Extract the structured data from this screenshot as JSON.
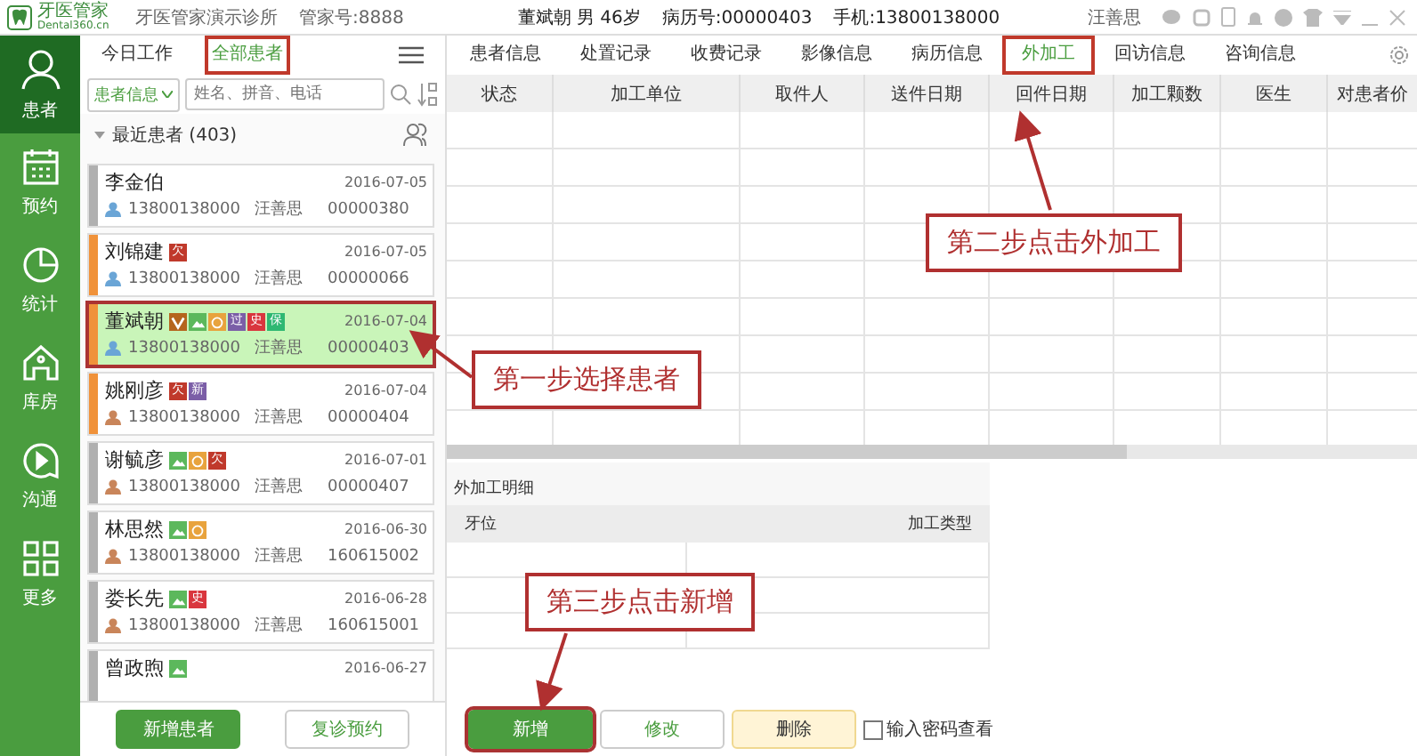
{
  "top_bar": {
    "logo_title": "牙医管家",
    "logo_subtitle": "Dental360.cn",
    "clinic": "牙医管家演示诊所",
    "account": "管家号:8888",
    "patient": "董斌朝 男 46岁",
    "record_no": "病历号:00000403",
    "phone": "手机:13800138000",
    "user": "汪善思"
  },
  "sidebar": {
    "items": [
      {
        "label": "患者",
        "selected": true
      },
      {
        "label": "预约",
        "selected": false
      },
      {
        "label": "统计",
        "selected": false
      },
      {
        "label": "库房",
        "selected": false
      },
      {
        "label": "沟通",
        "selected": false
      },
      {
        "label": "更多",
        "selected": false
      }
    ]
  },
  "patient_panel": {
    "tabs": [
      {
        "label": "今日工作",
        "selected": false,
        "highlighted": false
      },
      {
        "label": "全部患者",
        "selected": true,
        "highlighted": true
      }
    ],
    "filter": "患者信息",
    "search_placeholder": "姓名、拼音、电话",
    "group_title": "最近患者 (403)",
    "patients": [
      {
        "name": "李金伯",
        "date": "2016-07-05",
        "phone": "13800138000",
        "doctor": "汪善思",
        "id": "00000380",
        "color": "#b0b0b0",
        "kind": "male",
        "selected": false,
        "highlighted": false
      },
      {
        "name": "刘锦建",
        "date": "2016-07-05",
        "phone": "13800138000",
        "doctor": "汪善思",
        "id": "00000066",
        "color": "#f0923a",
        "kind": "male",
        "selected": false,
        "highlighted": false,
        "tags": [
          {
            "kind": "text",
            "text": "欠",
            "color": "#c0392b"
          }
        ]
      },
      {
        "name": "董斌朝",
        "date": "2016-07-04",
        "phone": "13800138000",
        "doctor": "汪善思",
        "id": "00000403",
        "color": "#f0923a",
        "kind": "male",
        "selected": true,
        "highlighted": true,
        "tags": [
          {
            "kind": "vip",
            "color": "#b5651d"
          },
          {
            "kind": "image",
            "color": "#5cb85c"
          },
          {
            "kind": "face",
            "color": "#e8a33d"
          },
          {
            "kind": "text",
            "text": "过",
            "color": "#7b5ea7"
          },
          {
            "kind": "text",
            "text": "史",
            "color": "#d9363e"
          },
          {
            "kind": "text",
            "text": "保",
            "color": "#2eb872"
          }
        ]
      },
      {
        "name": "姚刚彦",
        "date": "2016-07-04",
        "phone": "13800138000",
        "doctor": "汪善思",
        "id": "00000404",
        "color": "#f0923a",
        "kind": "female",
        "selected": false,
        "highlighted": false,
        "tags": [
          {
            "kind": "text",
            "text": "欠",
            "color": "#c0392b"
          },
          {
            "kind": "text",
            "text": "新",
            "color": "#7b5ea7"
          }
        ]
      },
      {
        "name": "谢毓彦",
        "date": "2016-07-01",
        "phone": "13800138000",
        "doctor": "汪善思",
        "id": "00000407",
        "color": "#b0b0b0",
        "kind": "female",
        "selected": false,
        "highlighted": false,
        "tags": [
          {
            "kind": "image",
            "color": "#5cb85c"
          },
          {
            "kind": "face",
            "color": "#e8a33d"
          },
          {
            "kind": "text",
            "text": "欠",
            "color": "#c0392b"
          }
        ]
      },
      {
        "name": "林思然",
        "date": "2016-06-30",
        "phone": "13800138000",
        "doctor": "汪善思",
        "id": "160615002",
        "color": "#b0b0b0",
        "kind": "female",
        "selected": false,
        "highlighted": false,
        "tags": [
          {
            "kind": "image",
            "color": "#5cb85c"
          },
          {
            "kind": "face",
            "color": "#e8a33d"
          }
        ]
      },
      {
        "name": "娄长先",
        "date": "2016-06-28",
        "phone": "13800138000",
        "doctor": "汪善思",
        "id": "160615001",
        "color": "#b0b0b0",
        "kind": "female",
        "selected": false,
        "highlighted": false,
        "tags": [
          {
            "kind": "image",
            "color": "#5cb85c"
          },
          {
            "kind": "text",
            "text": "史",
            "color": "#d9363e"
          }
        ]
      },
      {
        "name": "曾政煦",
        "date": "2016-06-27",
        "color": "#b0b0b0",
        "selected": false,
        "highlighted": false,
        "tags": [
          {
            "kind": "image",
            "color": "#5cb85c"
          }
        ]
      }
    ],
    "buttons": [
      {
        "label": "新增患者",
        "kind": "primary"
      },
      {
        "label": "复诊预约",
        "kind": "outline"
      }
    ]
  },
  "detail": {
    "tabs": [
      {
        "label": "患者信息",
        "selected": false,
        "highlighted": false
      },
      {
        "label": "处置记录",
        "selected": false,
        "highlighted": false
      },
      {
        "label": "收费记录",
        "selected": false,
        "highlighted": false
      },
      {
        "label": "影像信息",
        "selected": false,
        "highlighted": false
      },
      {
        "label": "病历信息",
        "selected": false,
        "highlighted": false
      },
      {
        "label": "外加工",
        "selected": true,
        "highlighted": true
      },
      {
        "label": "回访信息",
        "selected": false,
        "highlighted": false
      },
      {
        "label": "咨询信息",
        "selected": false,
        "highlighted": false
      }
    ],
    "table": {
      "columns": [
        "状态",
        "加工单位",
        "取件人",
        "送件日期",
        "回件日期",
        "加工颗数",
        "医生",
        "对患者价"
      ]
    },
    "items_title": "外加工明细",
    "items_table": {
      "columns": [
        "牙位",
        "加工类型"
      ]
    },
    "buttons": [
      {
        "label": "新增",
        "kind": "primary",
        "highlighted": true
      },
      {
        "label": "修改",
        "kind": "outline",
        "highlighted": false
      },
      {
        "label": "删除",
        "kind": "warning",
        "highlighted": false
      }
    ],
    "password_option": {
      "label": "输入密码查看",
      "checked": false
    }
  },
  "annotations": [
    {
      "text": "第一步选择患者"
    },
    {
      "text": "第二步点击外加工"
    },
    {
      "text": "第三步点击新增"
    }
  ]
}
